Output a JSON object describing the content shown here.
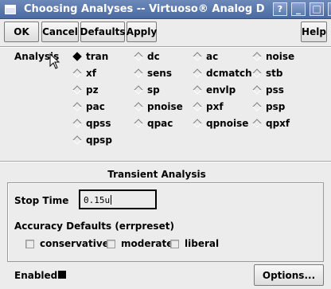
{
  "window": {
    "title": "Choosing Analyses -- Virtuoso® Analog D"
  },
  "titlebar_buttons": {
    "help": "?",
    "minimize": "_",
    "maximize": "□",
    "close": "×"
  },
  "toolbar": {
    "ok": "OK",
    "cancel": "Cancel",
    "defaults": "Defaults",
    "apply": "Apply",
    "help": "Help"
  },
  "analysis": {
    "label": "Analysis",
    "selected": "tran",
    "options": [
      "tran",
      "dc",
      "ac",
      "noise",
      "xf",
      "sens",
      "dcmatch",
      "stb",
      "pz",
      "sp",
      "envlp",
      "pss",
      "pac",
      "pnoise",
      "pxf",
      "psp",
      "qpss",
      "qpac",
      "qpnoise",
      "qpxf",
      "qpsp"
    ]
  },
  "transient": {
    "section_title": "Transient Analysis",
    "stop_time_label": "Stop Time",
    "stop_time_value": "0.15u",
    "accuracy_label": "Accuracy Defaults (errpreset)",
    "accuracy_options": [
      "conservative",
      "moderate",
      "liberal"
    ],
    "enabled_label": "Enabled",
    "enabled": true,
    "options_button": "Options..."
  }
}
